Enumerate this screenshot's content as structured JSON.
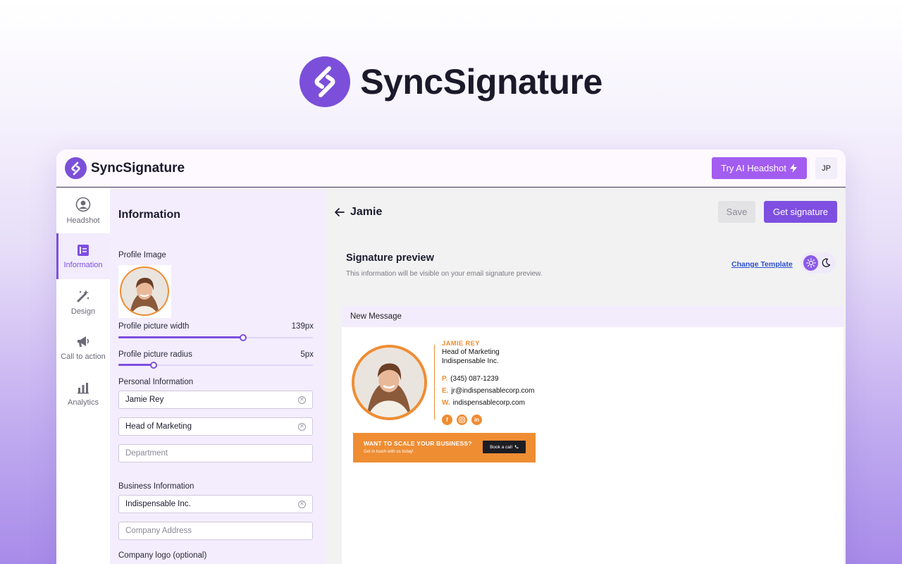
{
  "hero": {
    "title": "SyncSignature"
  },
  "topbar": {
    "brand_name": "SyncSignature",
    "try_ai_label": "Try AI Headshot",
    "user_initials": "JP"
  },
  "nav": {
    "items": [
      {
        "label": "Headshot",
        "icon": "user-circle-icon",
        "active": false
      },
      {
        "label": "Information",
        "icon": "id-card-icon",
        "active": true
      },
      {
        "label": "Design",
        "icon": "magic-wand-icon",
        "active": false
      },
      {
        "label": "Call to action",
        "icon": "megaphone-icon",
        "active": false
      },
      {
        "label": "Analytics",
        "icon": "bar-chart-icon",
        "active": false
      }
    ]
  },
  "panel": {
    "title": "Information",
    "profile_image_label": "Profile Image",
    "width_label": "Profile picture width",
    "width_value": "139px",
    "width_fraction": 0.64,
    "radius_label": "Profile picture radius",
    "radius_value": "5px",
    "radius_fraction": 0.18,
    "personal_label": "Personal Information",
    "name_value": "Jamie Rey",
    "title_value": "Head of Marketing",
    "department_placeholder": "Department",
    "business_label": "Business Information",
    "company_value": "Indispensable Inc.",
    "address_placeholder": "Company Address",
    "logo_label": "Company logo (optional)"
  },
  "main": {
    "back_name": "Jamie",
    "save_label": "Save",
    "get_signature_label": "Get signature",
    "preview_title": "Signature preview",
    "preview_subtitle": "This information will be visible on your email signature preview.",
    "change_template_label": "Change Template",
    "mail_header": "New Message"
  },
  "signature": {
    "name": "JAMIE REY",
    "title": "Head of Marketing",
    "company": "Indispensable Inc.",
    "phone_key": "P.",
    "phone": "(345) 087-1239",
    "email_key": "E.",
    "email": "jr@indispensablecorp.com",
    "web_key": "W.",
    "web": "indispensablecorp.com",
    "socials": [
      "facebook-icon",
      "instagram-icon",
      "linkedin-icon"
    ],
    "accent_color": "#ef8d33",
    "cta_title": "WANT TO SCALE YOUR BUSINESS?",
    "cta_subtitle": "Get in touch with us today!",
    "cta_button": "Book a call"
  },
  "colors": {
    "brand_purple": "#7b4fd9",
    "try_ai_purple": "#a35cf0",
    "accent_orange": "#ef8d33"
  }
}
